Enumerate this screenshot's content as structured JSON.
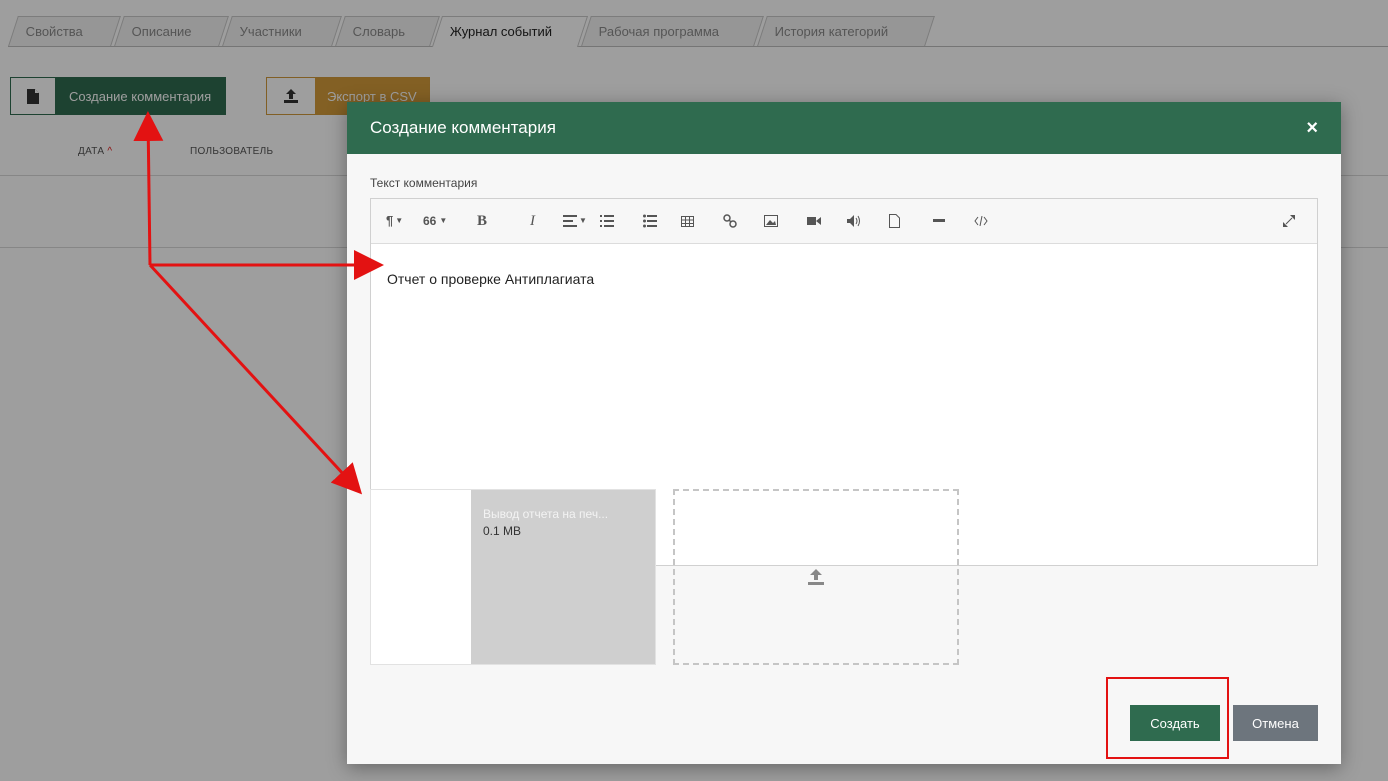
{
  "tabs": [
    {
      "label": "Свойства"
    },
    {
      "label": "Описание"
    },
    {
      "label": "Участники"
    },
    {
      "label": "Словарь"
    },
    {
      "label": "Журнал событий"
    },
    {
      "label": "Рабочая программа"
    },
    {
      "label": "История категорий"
    }
  ],
  "toolbar": {
    "create_comment_label": "Создание комментария",
    "export_label": "Экспорт в CSV"
  },
  "table": {
    "headers": [
      "ДАТА",
      "ПОЛЬЗОВАТЕЛЬ"
    ],
    "sort_indicator": "^"
  },
  "modal": {
    "title": "Создание комментария",
    "close": "×",
    "field_label": "Текст комментария",
    "editor_content": "Отчет о проверке Антиплагиата",
    "attachment": {
      "name": "Вывод отчета на печ...",
      "size": "0.1 MB"
    },
    "submit_label": "Создать",
    "cancel_label": "Отмена"
  },
  "editor_toolbar": {
    "paragraph_icon": "¶",
    "quote_icon": "66",
    "bold_icon": "B",
    "italic_icon": "I"
  },
  "colors": {
    "primary": "#2f6b4f",
    "export": "#d39b3a",
    "cancel": "#6d757d",
    "annotation": "#e31212"
  }
}
